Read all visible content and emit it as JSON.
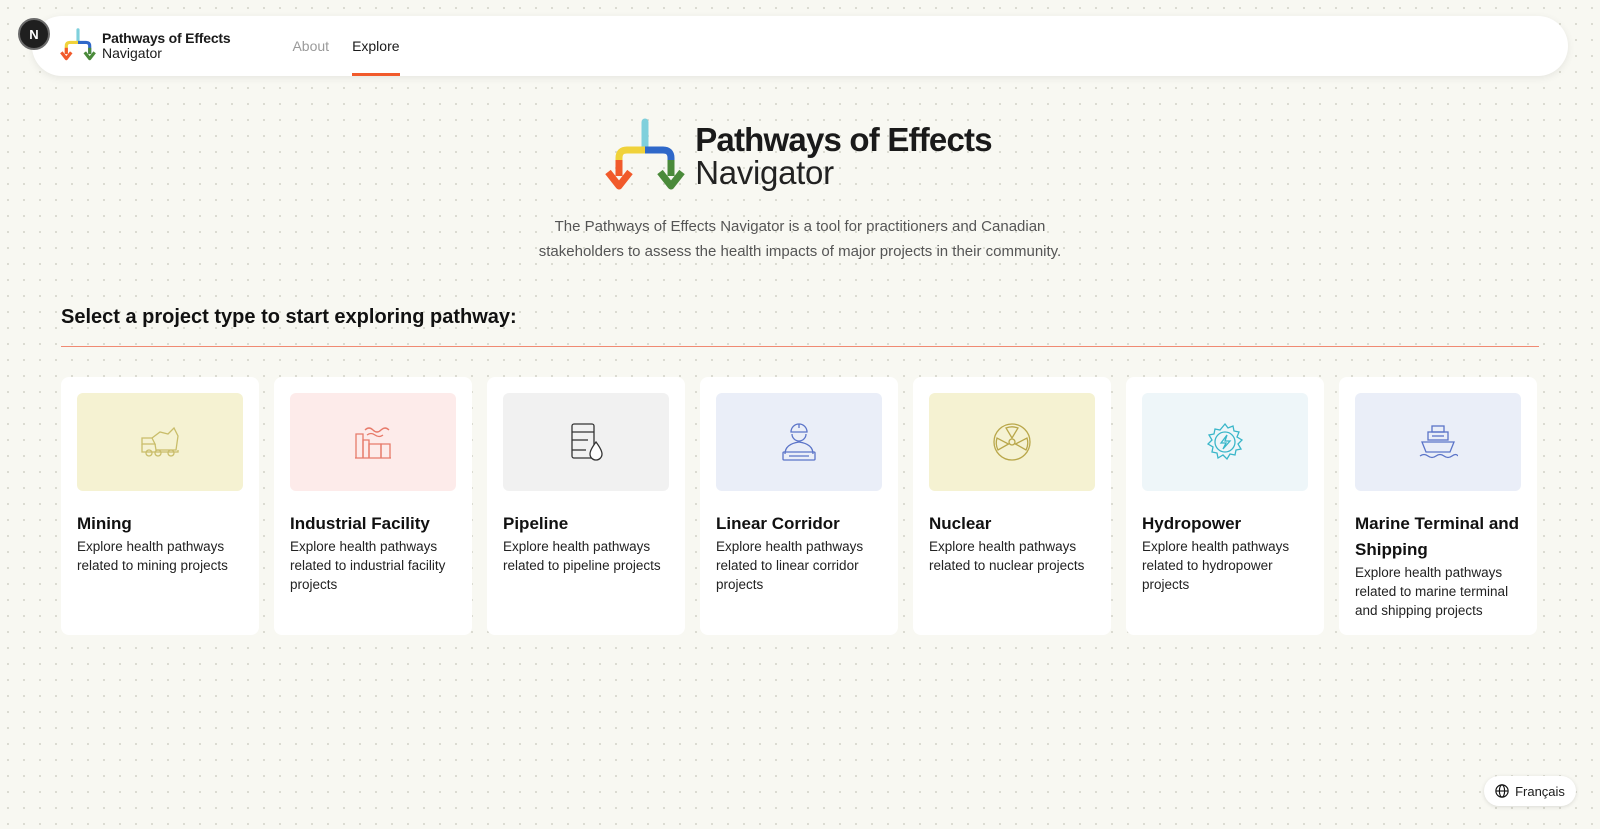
{
  "nav": {
    "brand_title": "Pathways of Effects",
    "brand_subtitle": "Navigator",
    "links": [
      {
        "label": "About",
        "active": false
      },
      {
        "label": "Explore",
        "active": true
      }
    ],
    "badge": "N"
  },
  "hero": {
    "title": "Pathways of Effects",
    "subtitle": "Navigator",
    "description": "The Pathways of Effects Navigator is a tool for practitioners and Canadian stakeholders to assess the health impacts of major projects in their community."
  },
  "section": {
    "heading": "Select a project type to start exploring pathway:"
  },
  "project_types": [
    {
      "title": "Mining",
      "description": "Explore health pathways related to mining projects",
      "icon": "mining-truck-icon",
      "bg": "#f5f2d2",
      "stroke": "#c9bd6a"
    },
    {
      "title": "Industrial Facility",
      "description": "Explore health pathways related to industrial facility projects",
      "icon": "factory-icon",
      "bg": "#fdebea",
      "stroke": "#e77a6a"
    },
    {
      "title": "Pipeline",
      "description": "Explore health pathways related to pipeline projects",
      "icon": "oil-barrel-icon",
      "bg": "#f1f1f1",
      "stroke": "#333333"
    },
    {
      "title": "Linear Corridor",
      "description": "Explore health pathways related to linear corridor projects",
      "icon": "engineer-icon",
      "bg": "#eaeef8",
      "stroke": "#5b74c8"
    },
    {
      "title": "Nuclear",
      "description": "Explore health pathways related to nuclear projects",
      "icon": "radiation-icon",
      "bg": "#f5f2d2",
      "stroke": "#b9a74a"
    },
    {
      "title": "Hydropower",
      "description": "Explore health pathways related to hydropower projects",
      "icon": "power-gear-icon",
      "bg": "#eef6f9",
      "stroke": "#39b6c9"
    },
    {
      "title": "Marine Terminal and Shipping",
      "description": "Explore health pathways related to marine terminal and shipping projects",
      "icon": "ship-icon",
      "bg": "#eaeef8",
      "stroke": "#5b74c8"
    }
  ],
  "language_toggle": {
    "label": "Français"
  }
}
